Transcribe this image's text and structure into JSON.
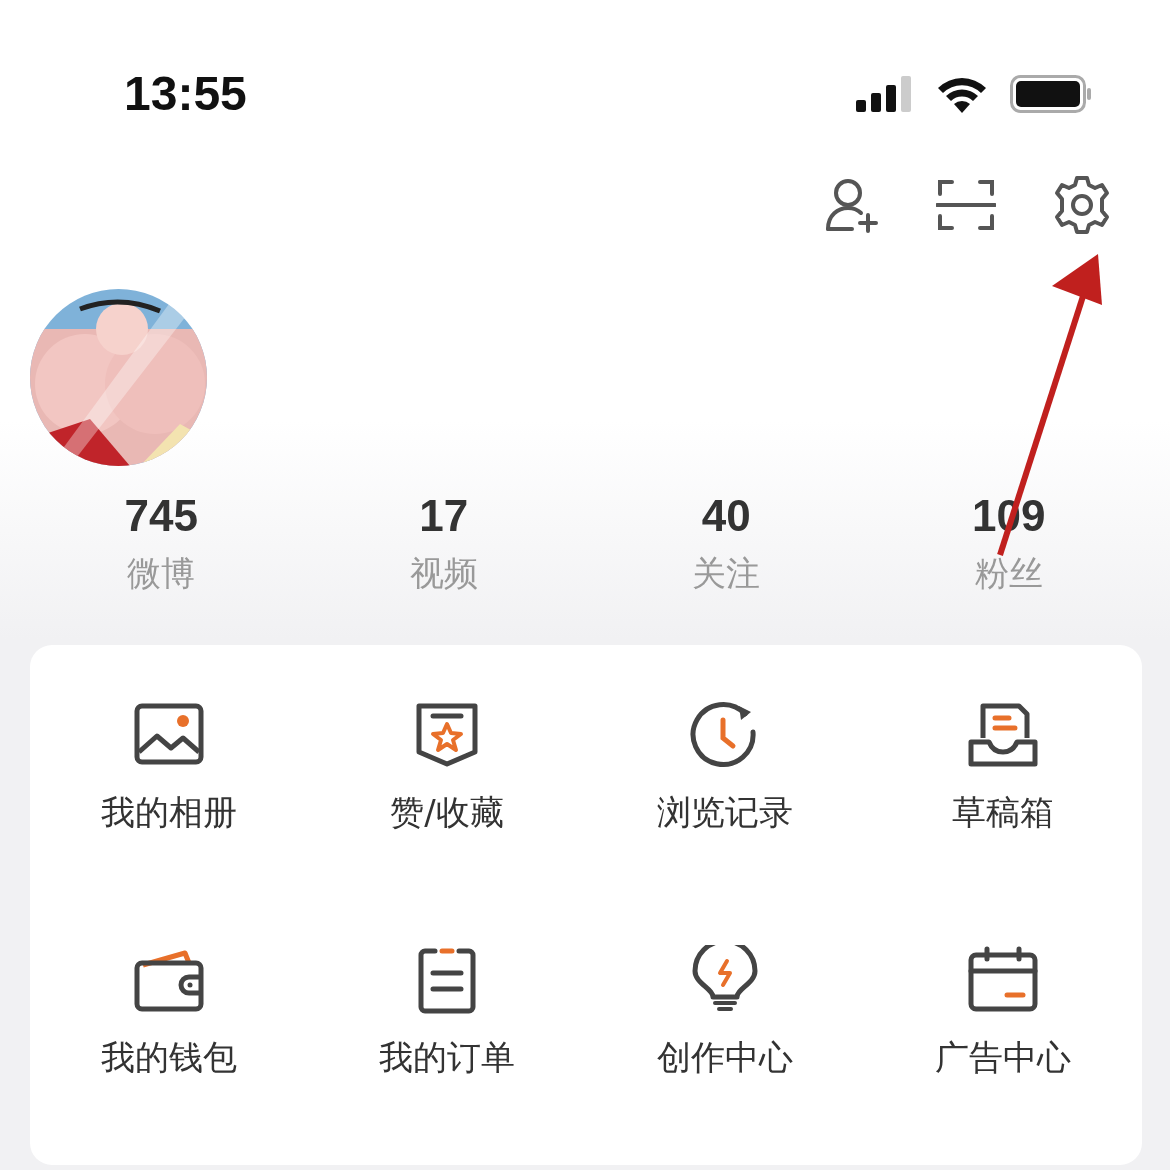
{
  "status_bar": {
    "time": "13:55"
  },
  "stats": [
    {
      "value": "745",
      "label": "微博"
    },
    {
      "value": "17",
      "label": "视频"
    },
    {
      "value": "40",
      "label": "关注"
    },
    {
      "value": "109",
      "label": "粉丝"
    }
  ],
  "menu_items": [
    {
      "label": "我的相册"
    },
    {
      "label": "赞/收藏"
    },
    {
      "label": "浏览记录"
    },
    {
      "label": "草稿箱"
    },
    {
      "label": "我的钱包"
    },
    {
      "label": "我的订单"
    },
    {
      "label": "创作中心"
    },
    {
      "label": "广告中心"
    }
  ]
}
